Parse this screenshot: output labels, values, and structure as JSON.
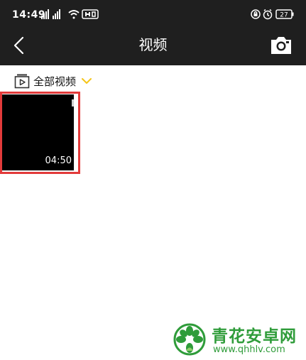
{
  "status_bar": {
    "time": "14:49",
    "battery": "27"
  },
  "toolbar": {
    "title": "视频"
  },
  "filter": {
    "label": "全部视频"
  },
  "videos": [
    {
      "duration": "04:50"
    }
  ],
  "watermark": {
    "name": "青花安卓网",
    "url": "www.qhhlv.com"
  },
  "colors": {
    "bar_background": "#1f1f1f",
    "accent_yellow": "#f5c518",
    "highlight_red": "#e23a3a",
    "watermark_green": "#2f9c3a"
  },
  "icons": [
    "signal-icon",
    "wifi-icon",
    "hd-icon",
    "lock-icon",
    "alarm-icon",
    "battery-icon",
    "back-arrow-icon",
    "camera-icon",
    "album-icon",
    "chevron-down-icon",
    "watermark-logo-icon"
  ]
}
